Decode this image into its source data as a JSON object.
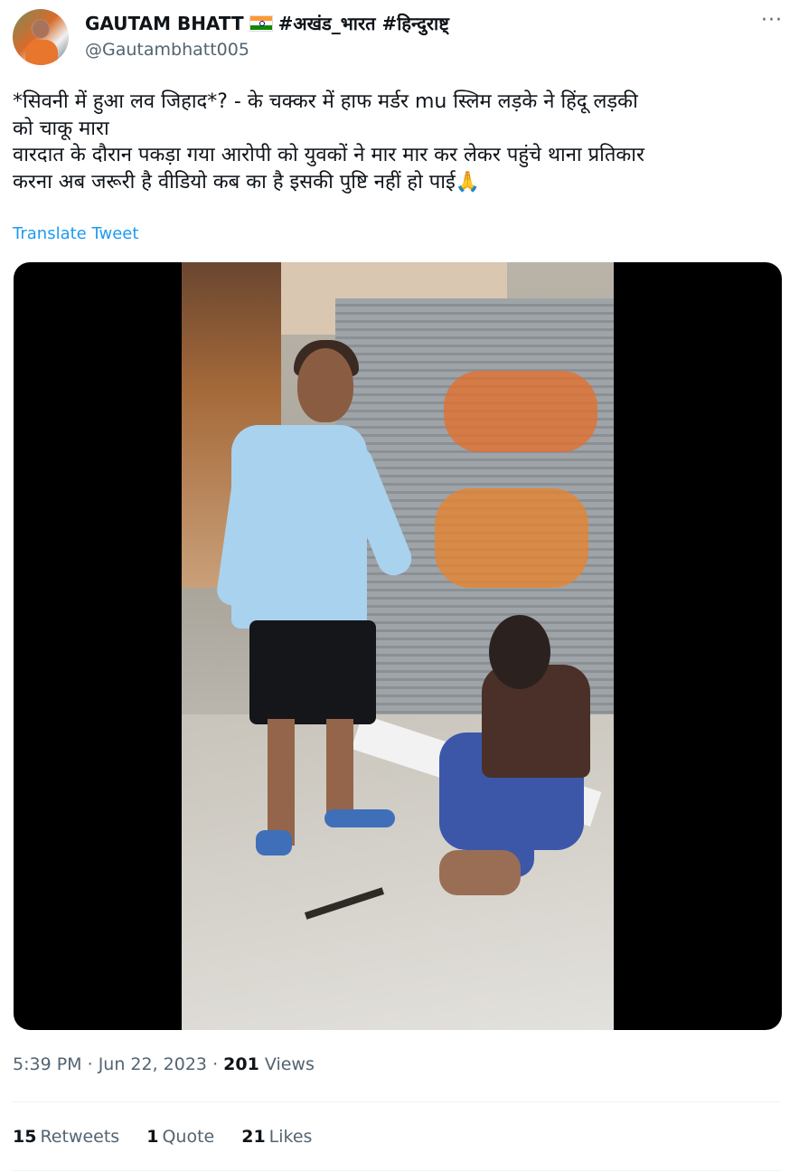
{
  "author": {
    "display_name": "GAUTAM BHATT",
    "hashtags": "#अखंड_भारत #हिन्दुराष्ट्",
    "handle": "@Gautambhatt005"
  },
  "menu": {
    "more_label": "···"
  },
  "tweet": {
    "text": "*सिवनी में हुआ लव जिहाद*? - के चक्कर में हाफ मर्डर mu स्लिम लड़के ने हिंदू लड़की\nको चाकू मारा\nवारदात के दौरान पकड़ा गया आरोपी को युवकों ने मार मार कर लेकर पहुंचे थाना प्रतिकार\nकरना अब जरूरी है वीडियो कब का है इसकी पुष्टि नहीं हो पाई🙏",
    "translate_label": "Translate Tweet"
  },
  "meta": {
    "time": "5:39 PM",
    "sep1": " · ",
    "date": "Jun 22, 2023",
    "sep2": " · ",
    "views_count": "201",
    "views_label": " Views"
  },
  "stats": {
    "retweets_count": "15",
    "retweets_label": "Retweets",
    "quote_count": "1",
    "quote_label": "Quote",
    "likes_count": "21",
    "likes_label": "Likes"
  },
  "colors": {
    "link": "#1d9bf0",
    "secondary_text": "#536471",
    "primary_text": "#0f1419"
  }
}
